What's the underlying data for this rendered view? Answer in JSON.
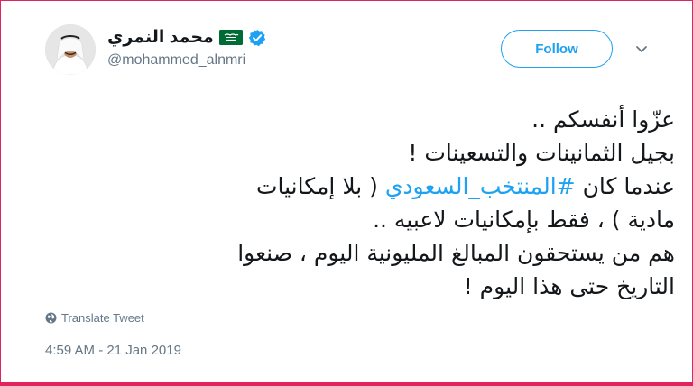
{
  "tweet": {
    "author": {
      "display_name": "محمد النمري",
      "handle": "@mohammed_alnmri"
    },
    "follow_label": "Follow",
    "text": {
      "line1": "عزّوا أنفسكم ..",
      "line2": "بجيل الثمانينات والتسعينات !",
      "line3_before": "عندما كان ",
      "hashtag": "#المنتخب_السعودي",
      "line3_after": " ( بلا إمكانيات",
      "line4": "مادية ) ، فقط بإمكانيات لاعبيه ..",
      "line5": "هم من يستحقون المبالغ المليونية اليوم ، صنعوا",
      "line6": "التاريخ حتى هذا اليوم !"
    },
    "translate_label": "Translate Tweet",
    "timestamp": "4:59 AM - 21 Jan 2019"
  },
  "colors": {
    "accent": "#1da1f2",
    "text": "#14171a",
    "muted": "#657786",
    "flag_green": "#006c35",
    "frame_red": "#e0245e"
  },
  "icons": {
    "flag": "saudi-flag-icon",
    "verified": "verified-badge-icon",
    "chevron": "chevron-down-icon",
    "globe": "globe-icon"
  }
}
